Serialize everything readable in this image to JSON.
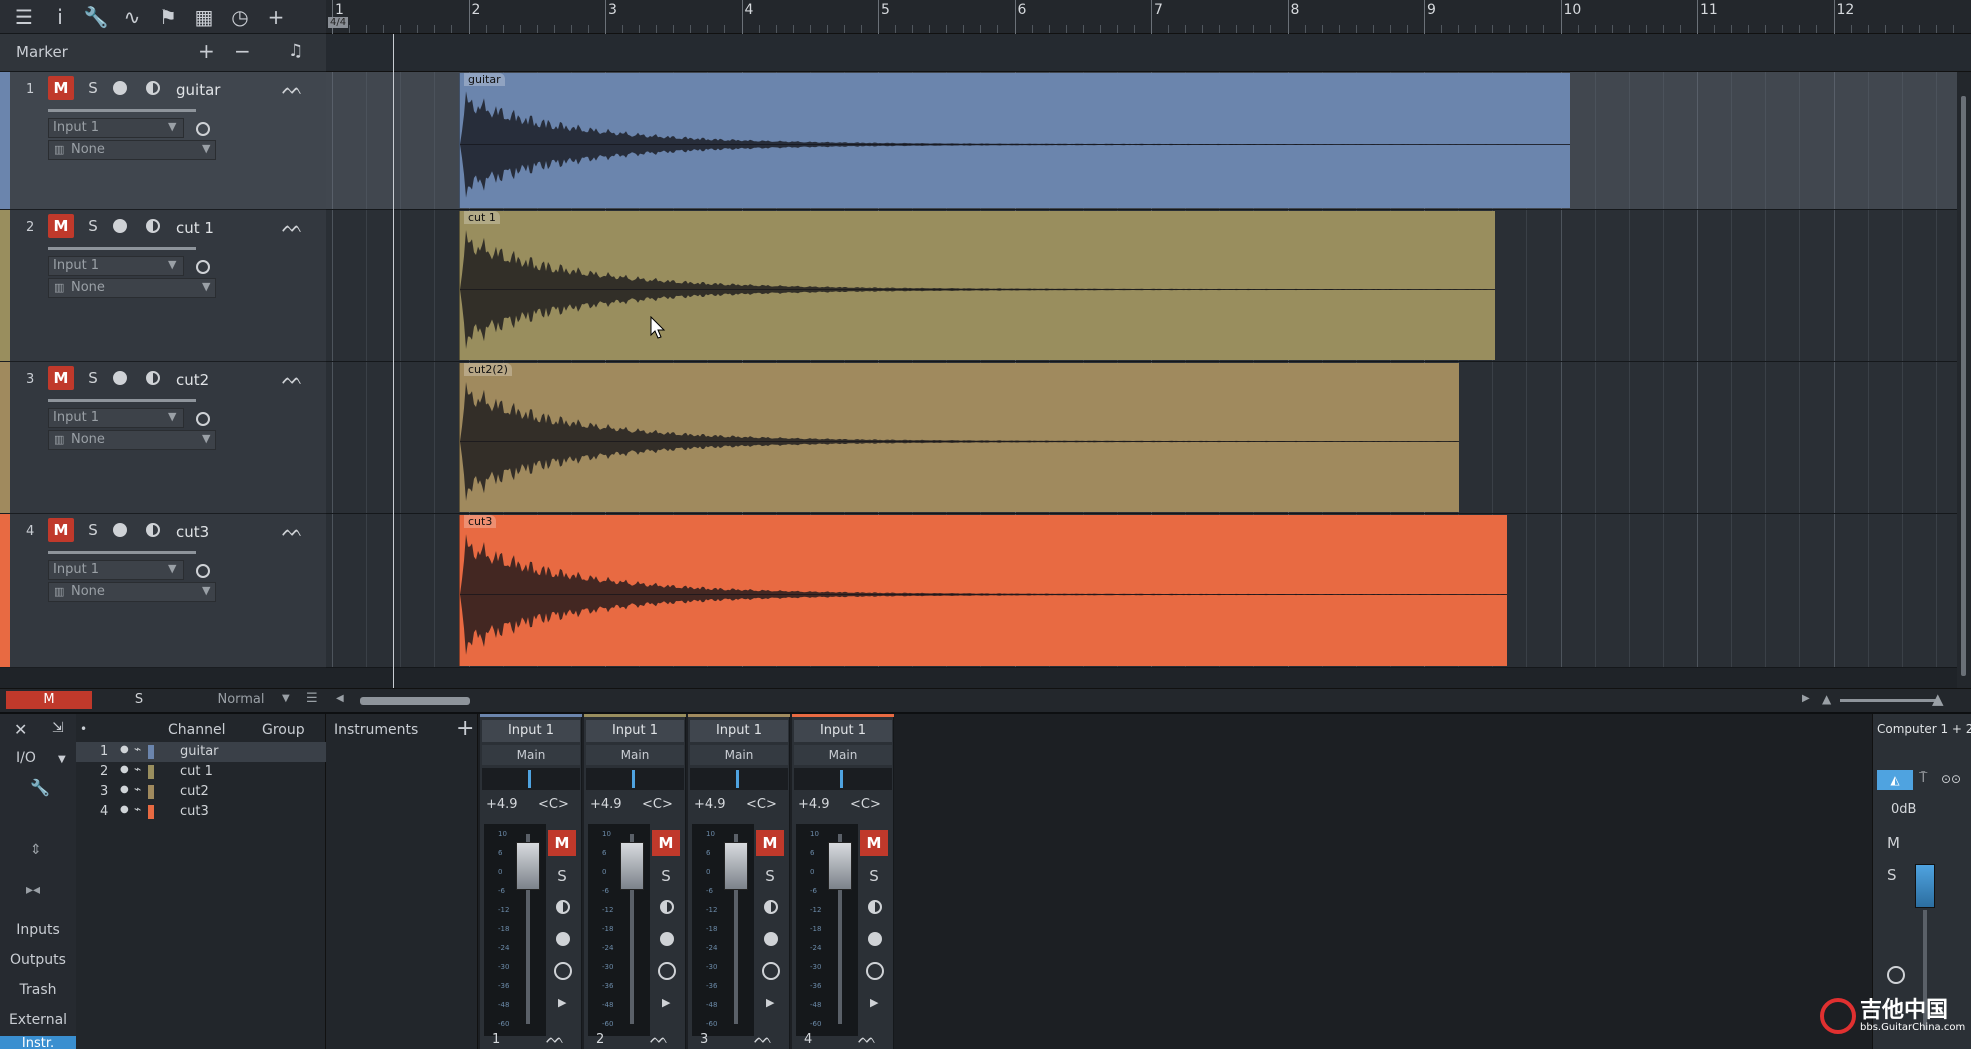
{
  "toolbar": {
    "icons": [
      "menu-icon",
      "info-icon",
      "wrench-icon",
      "curve-icon",
      "flag-icon",
      "grid-icon",
      "clock-icon",
      "plus-icon"
    ]
  },
  "ruler": {
    "time_signature": "4/4",
    "bars": [
      "1",
      "2",
      "3",
      "4",
      "5",
      "6",
      "7",
      "8",
      "9",
      "10",
      "11",
      "12"
    ]
  },
  "marker": {
    "label": "Marker",
    "add": "+",
    "remove": "−",
    "note_icon": "♫"
  },
  "tracks": [
    {
      "num": "1",
      "name": "guitar",
      "m": "M",
      "s": "S",
      "input": "Input 1",
      "output": "None",
      "color": "#6b85ad",
      "clip_label": "guitar",
      "clip_color": "#6b85ad",
      "selected": true
    },
    {
      "num": "2",
      "name": "cut 1",
      "m": "M",
      "s": "S",
      "input": "Input 1",
      "output": "None",
      "color": "#998e5e",
      "clip_label": "cut 1",
      "clip_color": "#998e5e",
      "selected": false
    },
    {
      "num": "3",
      "name": "cut2",
      "m": "M",
      "s": "S",
      "input": "Input 1",
      "output": "None",
      "color": "#a08a5e",
      "clip_label": "cut2(2)",
      "clip_color": "#a08a5e",
      "selected": false
    },
    {
      "num": "4",
      "name": "cut3",
      "m": "M",
      "s": "S",
      "input": "Input 1",
      "output": "None",
      "color": "#e86a42",
      "clip_label": "cut3",
      "clip_color": "#e86a42",
      "selected": false
    }
  ],
  "footer": {
    "m": "M",
    "s": "S",
    "mode": "Normal"
  },
  "console": {
    "nav": [
      "I/O",
      "Inputs",
      "Outputs",
      "Trash",
      "External",
      "Instr."
    ],
    "list_headers": {
      "channel": "Channel",
      "group": "Group"
    },
    "channels": [
      {
        "num": "1",
        "name": "guitar",
        "color": "#6b85ad"
      },
      {
        "num": "2",
        "name": "cut 1",
        "color": "#998e5e"
      },
      {
        "num": "3",
        "name": "cut2",
        "color": "#a08a5e"
      },
      {
        "num": "4",
        "name": "cut3",
        "color": "#e86a42"
      }
    ],
    "instruments_title": "Instruments",
    "strips": [
      {
        "input": "Input 1",
        "output": "Main",
        "volume": "+4.9",
        "pan": "<C>",
        "m": "M",
        "s": "S",
        "num": "1",
        "color": "#6b85ad"
      },
      {
        "input": "Input 1",
        "output": "Main",
        "volume": "+4.9",
        "pan": "<C>",
        "m": "M",
        "s": "S",
        "num": "2",
        "color": "#998e5e"
      },
      {
        "input": "Input 1",
        "output": "Main",
        "volume": "+4.9",
        "pan": "<C>",
        "m": "M",
        "s": "S",
        "num": "3",
        "color": "#a08a5e"
      },
      {
        "input": "Input 1",
        "output": "Main",
        "volume": "+4.9",
        "pan": "<C>",
        "m": "M",
        "s": "S",
        "num": "4",
        "color": "#e86a42"
      }
    ],
    "main": {
      "title": "Computer 1 + 2",
      "level": "0dB",
      "m": "M",
      "s": "S"
    }
  },
  "watermark": {
    "main": "吉他中国",
    "sub": "bbs.GuitarChina.com"
  }
}
